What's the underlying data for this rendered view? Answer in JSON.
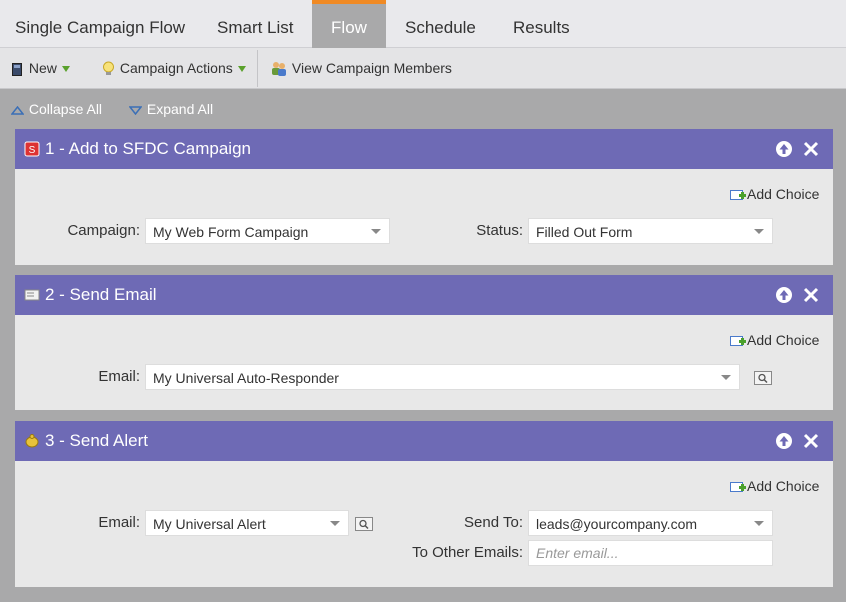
{
  "tabs": [
    {
      "label": "Single Campaign Flow"
    },
    {
      "label": "Smart List"
    },
    {
      "label": "Flow",
      "active": true
    },
    {
      "label": "Schedule"
    },
    {
      "label": "Results"
    }
  ],
  "toolbar": {
    "new_label": "New",
    "campaign_actions_label": "Campaign Actions",
    "view_members_label": "View Campaign Members"
  },
  "controls": {
    "collapse_all": "Collapse All",
    "expand_all": "Expand All"
  },
  "steps": [
    {
      "title": "1 - Add to SFDC Campaign",
      "icon": "sfdc-icon",
      "add_choice": "Add Choice",
      "fields": {
        "campaign_label": "Campaign:",
        "campaign_value": "My Web Form Campaign",
        "status_label": "Status:",
        "status_value": "Filled Out Form"
      }
    },
    {
      "title": "2 - Send Email",
      "icon": "email-icon",
      "add_choice": "Add Choice",
      "fields": {
        "email_label": "Email:",
        "email_value": "My Universal Auto-Responder"
      }
    },
    {
      "title": "3 - Send Alert",
      "icon": "alert-icon",
      "add_choice": "Add Choice",
      "fields": {
        "email_label": "Email:",
        "email_value": "My Universal Alert",
        "send_to_label": "Send To:",
        "send_to_value": "leads@yourcompany.com",
        "other_emails_label": "To Other Emails:",
        "other_emails_placeholder": "Enter email..."
      }
    }
  ],
  "colors": {
    "step_header": "#6e6ab5",
    "active_tab_accent": "#f08a24",
    "background": "#a9a9aa"
  }
}
